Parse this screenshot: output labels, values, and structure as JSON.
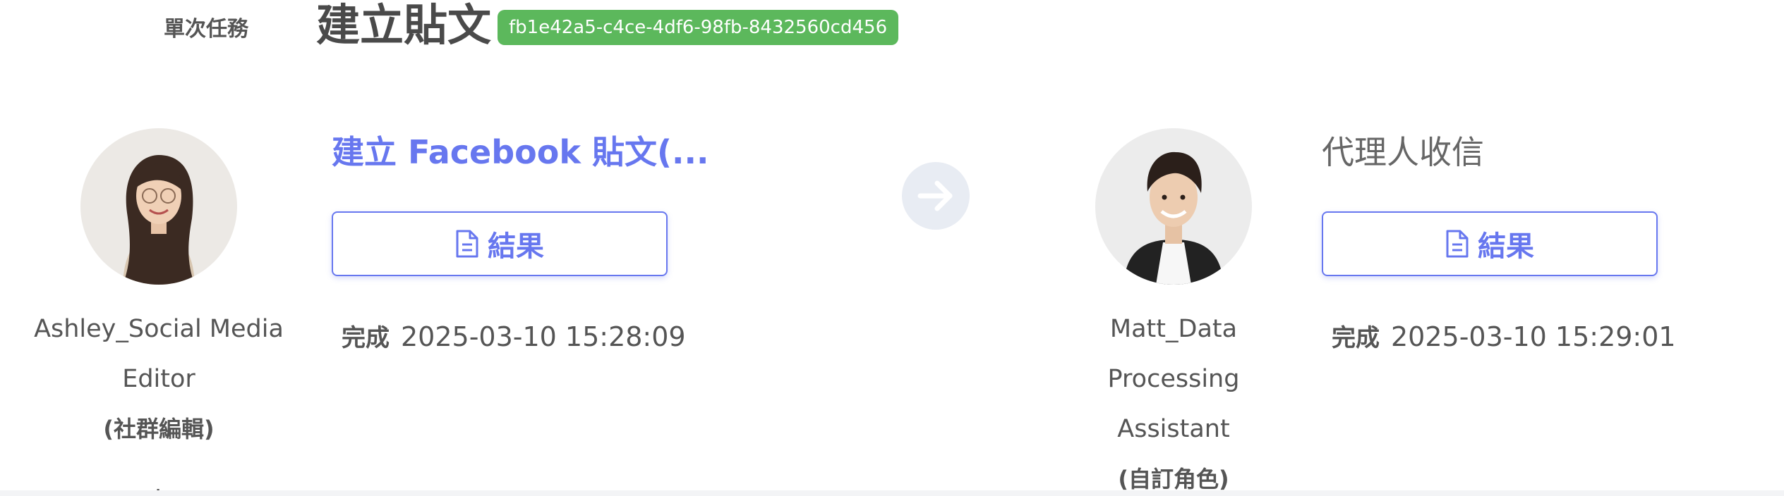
{
  "header": {
    "task_type": "單次任務",
    "task_title": "建立貼文",
    "task_id": "fb1e42a5-c4ce-4df6-98fb-8432560cd456"
  },
  "steps": [
    {
      "agent": {
        "name_lines": [
          "Ashley_Social Media",
          "Editor"
        ],
        "role": "(社群編輯)",
        "extra": "."
      },
      "title": "建立 Facebook 貼文(...",
      "result_label": "結果",
      "status": "完成",
      "timestamp": "2025-03-10 15:28:09"
    },
    {
      "agent": {
        "name_lines": [
          "Matt_Data",
          "Processing",
          "Assistant"
        ],
        "role": "(自訂角色)"
      },
      "title": "代理人收信",
      "result_label": "結果",
      "status": "完成",
      "timestamp": "2025-03-10 15:29:01"
    }
  ],
  "icons": {
    "connector": "arrow-right-icon",
    "result": "document-icon"
  },
  "colors": {
    "accent": "#6777ef",
    "badge": "#5cb85c",
    "arrow_bg": "#e8ecf3"
  }
}
